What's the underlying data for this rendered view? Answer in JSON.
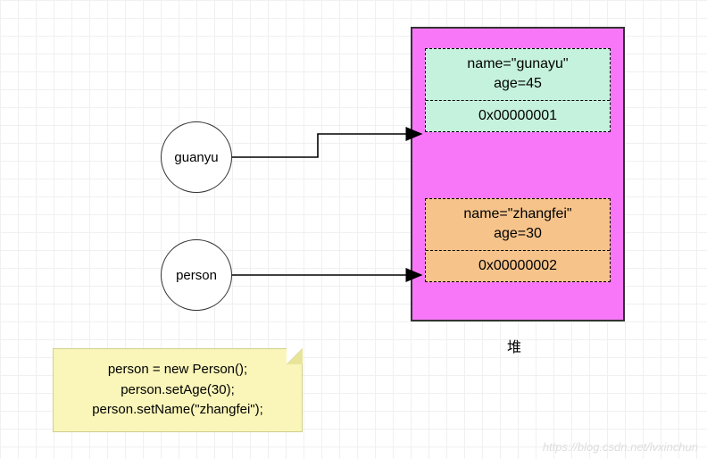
{
  "circles": {
    "guanyu": {
      "label": "guanyu"
    },
    "person": {
      "label": "person"
    }
  },
  "heap": {
    "label": "堆",
    "objects": [
      {
        "name_line": "name=\"gunayu\"",
        "age_line": "age=45",
        "address": "0x00000001",
        "color": "mint"
      },
      {
        "name_line": "name=\"zhangfei\"",
        "age_line": "age=30",
        "address": "0x00000002",
        "color": "orange"
      }
    ]
  },
  "note": {
    "line1": "person = new Person();",
    "line2": "person.setAge(30);",
    "line3": "person.setName(\"zhangfei\");"
  },
  "watermark": "https://blog.csdn.net/lvxinchun"
}
